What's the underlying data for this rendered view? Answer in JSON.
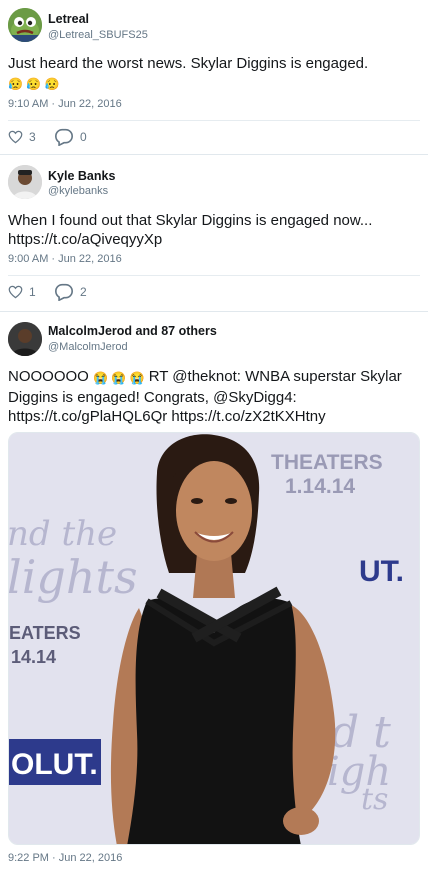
{
  "tweets": [
    {
      "name": "Letreal",
      "handle": "@Letreal_SBUFS25",
      "text": "Just heard the worst news. Skylar Diggins is engaged.",
      "emoji": "😥 😥 😥",
      "timestamp": "9:10 AM · Jun 22, 2016",
      "likes": "3",
      "replies": "0"
    },
    {
      "name": "Kyle Banks",
      "handle": "@kylebanks",
      "text_line1": "When I found out that Skylar Diggins is engaged now...",
      "text_line2": "https://t.co/aQiveqyyXp",
      "timestamp": "9:00 AM · Jun 22, 2016",
      "likes": "1",
      "replies": "2"
    },
    {
      "name": "MalcolmJerod and 87 others",
      "handle": "@MalcolmJerod",
      "text_part1": "NOOOOOO",
      "emoji": "😭 😭 😭",
      "text_part2": "RT @theknot: WNBA superstar Skylar",
      "text_line2": "Diggins is engaged! Congrats, @SkyDigg4:",
      "text_line3": "https://t.co/gPlaHQL6Qr https://t.co/zX2tKXHtny",
      "timestamp": "9:22 PM · Jun 22, 2016",
      "photo_backdrop": {
        "top_right_1": "THEATERS",
        "top_right_2": "1.14.14",
        "left_1": "nd the",
        "left_2": "lights",
        "left_3": "EATERS",
        "left_4": "14.14",
        "left_5": "OLUT.",
        "right_mid": "UT.",
        "right_low_1": "d t",
        "right_low_2": "igh",
        "right_low_3": "ts"
      }
    }
  ],
  "colors": {
    "text_primary": "#14171a",
    "text_secondary": "#657786",
    "separator": "#e1e8ed",
    "backdrop": "#d9d9e8"
  }
}
